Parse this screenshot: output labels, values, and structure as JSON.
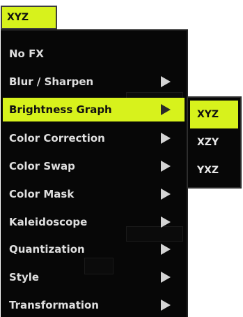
{
  "top_button": {
    "label": "XYZ"
  },
  "menu": {
    "items": [
      {
        "label": "No FX",
        "has_submenu": false,
        "selected": false
      },
      {
        "label": "Blur / Sharpen",
        "has_submenu": true,
        "selected": false
      },
      {
        "label": "Brightness Graph",
        "has_submenu": true,
        "selected": true
      },
      {
        "label": "Color Correction",
        "has_submenu": true,
        "selected": false
      },
      {
        "label": "Color Swap",
        "has_submenu": true,
        "selected": false
      },
      {
        "label": "Color Mask",
        "has_submenu": true,
        "selected": false
      },
      {
        "label": "Kaleidoscope",
        "has_submenu": true,
        "selected": false
      },
      {
        "label": "Quantization",
        "has_submenu": true,
        "selected": false
      },
      {
        "label": "Style",
        "has_submenu": true,
        "selected": false
      },
      {
        "label": "Transformation",
        "has_submenu": true,
        "selected": false
      }
    ]
  },
  "submenu": {
    "items": [
      {
        "label": "XYZ",
        "selected": true
      },
      {
        "label": "XZY",
        "selected": false
      },
      {
        "label": "YXZ",
        "selected": false
      }
    ]
  },
  "colors": {
    "accent": "#d7f21c",
    "menu_bg": "#070707",
    "text": "#dedede"
  },
  "icons": {
    "submenu_arrow": "triangle-right-icon"
  }
}
